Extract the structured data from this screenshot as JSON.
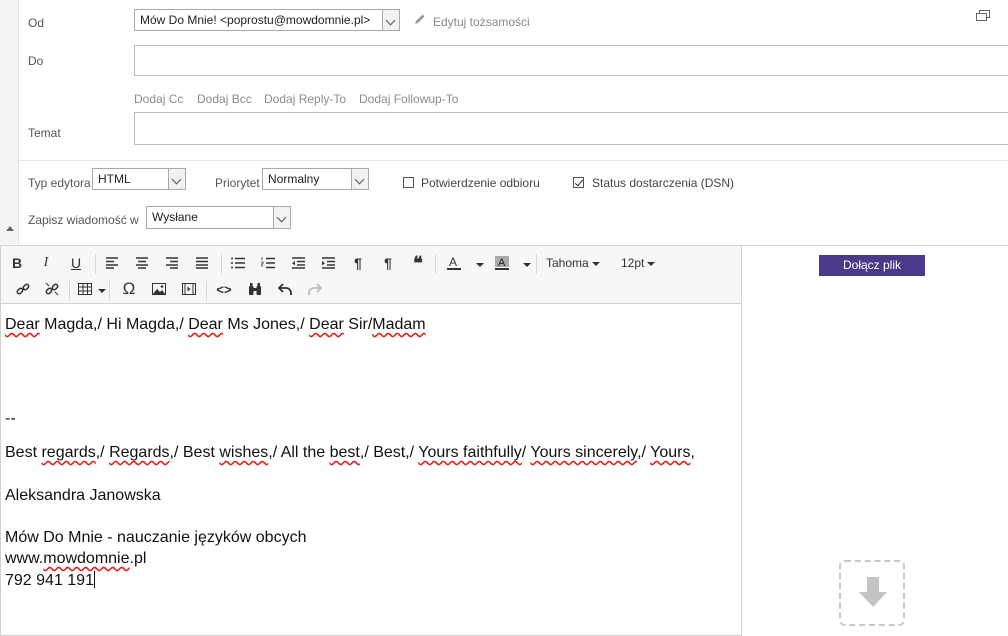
{
  "headers": {
    "from_label": "Od",
    "from_value": "Mów Do Mnie! <poprostu@mowdomnie.pl>",
    "edit_identity": "Edytuj tożsamości",
    "to_label": "Do",
    "to_value": "",
    "add_links": [
      "Dodaj Cc",
      "Dodaj Bcc",
      "Dodaj Reply-To",
      "Dodaj Followup-To"
    ],
    "subject_label": "Temat",
    "subject_value": ""
  },
  "options": {
    "editor_type_label": "Typ edytora",
    "editor_type_value": "HTML",
    "priority_label": "Priorytet",
    "priority_value": "Normalny",
    "read_receipt_label": "Potwierdzenie odbioru",
    "read_receipt_checked": false,
    "dsn_label": "Status dostarczenia (DSN)",
    "dsn_checked": true,
    "save_in_label": "Zapisz wiadomość w",
    "save_in_value": "Wysłane"
  },
  "toolbar": {
    "font_family": "Tahoma",
    "font_size": "12pt"
  },
  "body": {
    "line1": "Dear Magda,/ Hi Magda,/ Dear Ms Jones,/ Dear Sir/Madam",
    "sig_sep": "--",
    "line_regards": "Best regards,/ Regards,/ Best wishes,/ All the best,/ Best,/ Yours faithfully/ Yours sincerely,/ Yours,",
    "name": "Aleksandra Janowska",
    "company": "Mów Do Mnie - nauczanie języków obcych",
    "website": "www.mowdomnie.pl",
    "phone": "792 941 191"
  },
  "attachments": {
    "attach_button": "Dołącz plik"
  }
}
